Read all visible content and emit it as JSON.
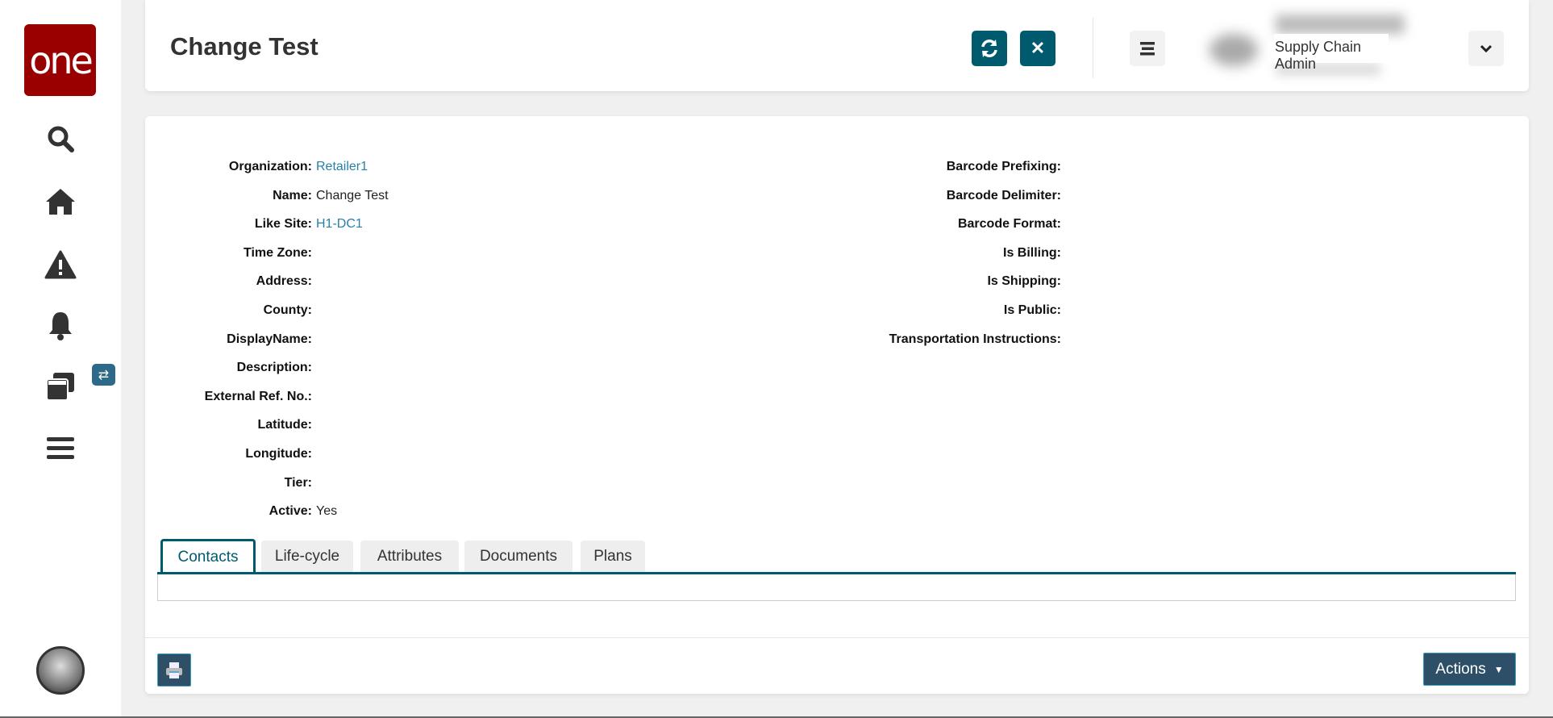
{
  "sidebar": {
    "logo_text": "one",
    "items": [
      {
        "name": "search",
        "icon": "search-icon"
      },
      {
        "name": "home",
        "icon": "home-icon"
      },
      {
        "name": "alerts",
        "icon": "warning-icon"
      },
      {
        "name": "notifications",
        "icon": "bell-icon"
      },
      {
        "name": "windows",
        "icon": "windows-icon"
      },
      {
        "name": "menu",
        "icon": "menu-icon"
      }
    ],
    "badge_icon": "swap-icon"
  },
  "header": {
    "title": "Change Test",
    "role": "Supply Chain Admin"
  },
  "details": {
    "left": [
      {
        "label": "Organization:",
        "value": "Retailer1",
        "link": true
      },
      {
        "label": "Name:",
        "value": "Change Test"
      },
      {
        "label": "Like Site:",
        "value": "H1-DC1",
        "link": true
      },
      {
        "label": "Time Zone:",
        "value": ""
      },
      {
        "label": "Address:",
        "value": ""
      },
      {
        "label": "County:",
        "value": ""
      },
      {
        "label": "DisplayName:",
        "value": ""
      },
      {
        "label": "Description:",
        "value": ""
      },
      {
        "label": "External Ref. No.:",
        "value": ""
      },
      {
        "label": "Latitude:",
        "value": ""
      },
      {
        "label": "Longitude:",
        "value": ""
      },
      {
        "label": "Tier:",
        "value": ""
      },
      {
        "label": "Active:",
        "value": "Yes"
      }
    ],
    "right": [
      {
        "label": "Barcode Prefixing:",
        "value": ""
      },
      {
        "label": "Barcode Delimiter:",
        "value": ""
      },
      {
        "label": "Barcode Format:",
        "value": ""
      },
      {
        "label": "Is Billing:",
        "value": ""
      },
      {
        "label": "Is Shipping:",
        "value": ""
      },
      {
        "label": "Is Public:",
        "value": ""
      },
      {
        "label": "Transportation Instructions:",
        "value": ""
      }
    ]
  },
  "tabs": [
    "Contacts",
    "Life-cycle",
    "Attributes",
    "Documents",
    "Plans"
  ],
  "active_tab": "Contacts",
  "footer": {
    "actions_label": "Actions"
  },
  "colors": {
    "brand": "#990000",
    "accent": "#005a6e",
    "link": "#2a7fa8",
    "button": "#2d4f68"
  }
}
